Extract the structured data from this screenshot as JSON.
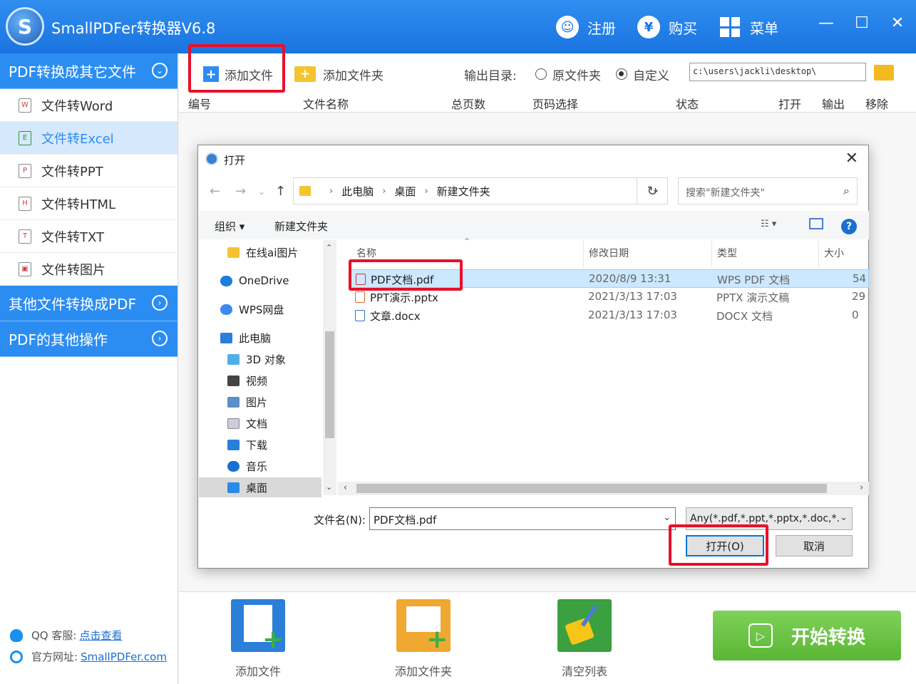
{
  "app": {
    "title": "SmallPDFer转换器V6.8",
    "register": "注册",
    "buy": "购买",
    "menu": "菜单",
    "minimize": "—",
    "maximize": "☐",
    "close": "✕"
  },
  "sidebar": {
    "section1": "PDF转换成其它文件",
    "items": [
      "文件转Word",
      "文件转Excel",
      "文件转PPT",
      "文件转HTML",
      "文件转TXT",
      "文件转图片"
    ],
    "item_icons": [
      "W",
      "E",
      "P",
      "H",
      "T",
      "▣"
    ],
    "active_index": 1,
    "section2": "其他文件转换成PDF",
    "section3": "PDF的其他操作",
    "qq_label": "QQ 客服:",
    "qq_link": "点击查看",
    "site_label": "官方网址:",
    "site_link": "SmallPDFer.com"
  },
  "toolbar": {
    "add_file": "添加文件",
    "add_folder": "添加文件夹",
    "output_label": "输出目录:",
    "radio_original": "原文件夹",
    "radio_custom": "自定义",
    "output_path": "c:\\users\\jackli\\desktop\\"
  },
  "columns": [
    "编号",
    "文件名称",
    "总页数",
    "页码选择",
    "状态",
    "打开",
    "输出",
    "移除"
  ],
  "bottom": {
    "add_file": "添加文件",
    "add_folder": "添加文件夹",
    "clear_list": "清空列表",
    "start": "开始转换"
  },
  "dialog": {
    "title": "打开",
    "breadcrumb": [
      "此电脑",
      "桌面",
      "新建文件夹"
    ],
    "search_placeholder": "搜索\"新建文件夹\"",
    "organize": "组织 ▾",
    "new_folder": "新建文件夹",
    "nav": [
      "在线ai图片",
      "OneDrive",
      "WPS网盘",
      "此电脑",
      "3D 对象",
      "视频",
      "图片",
      "文档",
      "下载",
      "音乐",
      "桌面"
    ],
    "headers": {
      "name": "名称",
      "modified": "修改日期",
      "type": "类型",
      "size": "大小"
    },
    "files": [
      {
        "name": "PDF文档.pdf",
        "modified": "2020/8/9 13:31",
        "type": "WPS PDF 文档",
        "size": "54",
        "icon_color": "#d9342b"
      },
      {
        "name": "PPT演示.pptx",
        "modified": "2021/3/13 17:03",
        "type": "PPTX 演示文稿",
        "size": "29",
        "icon_color": "#d96a2b"
      },
      {
        "name": "文章.docx",
        "modified": "2021/3/13 17:03",
        "type": "DOCX 文档",
        "size": "0",
        "icon_color": "#2b6ed9"
      }
    ],
    "filename_label": "文件名(N):",
    "filename_value": "PDF文档.pdf",
    "filetype": "Any(*.pdf,*.ppt,*.pptx,*.doc,*.",
    "open_btn": "打开(O)",
    "cancel_btn": "取消"
  },
  "colors": {
    "accent": "#2b8df2",
    "highlight": "#e8102a",
    "start_green": "#5bb634"
  }
}
